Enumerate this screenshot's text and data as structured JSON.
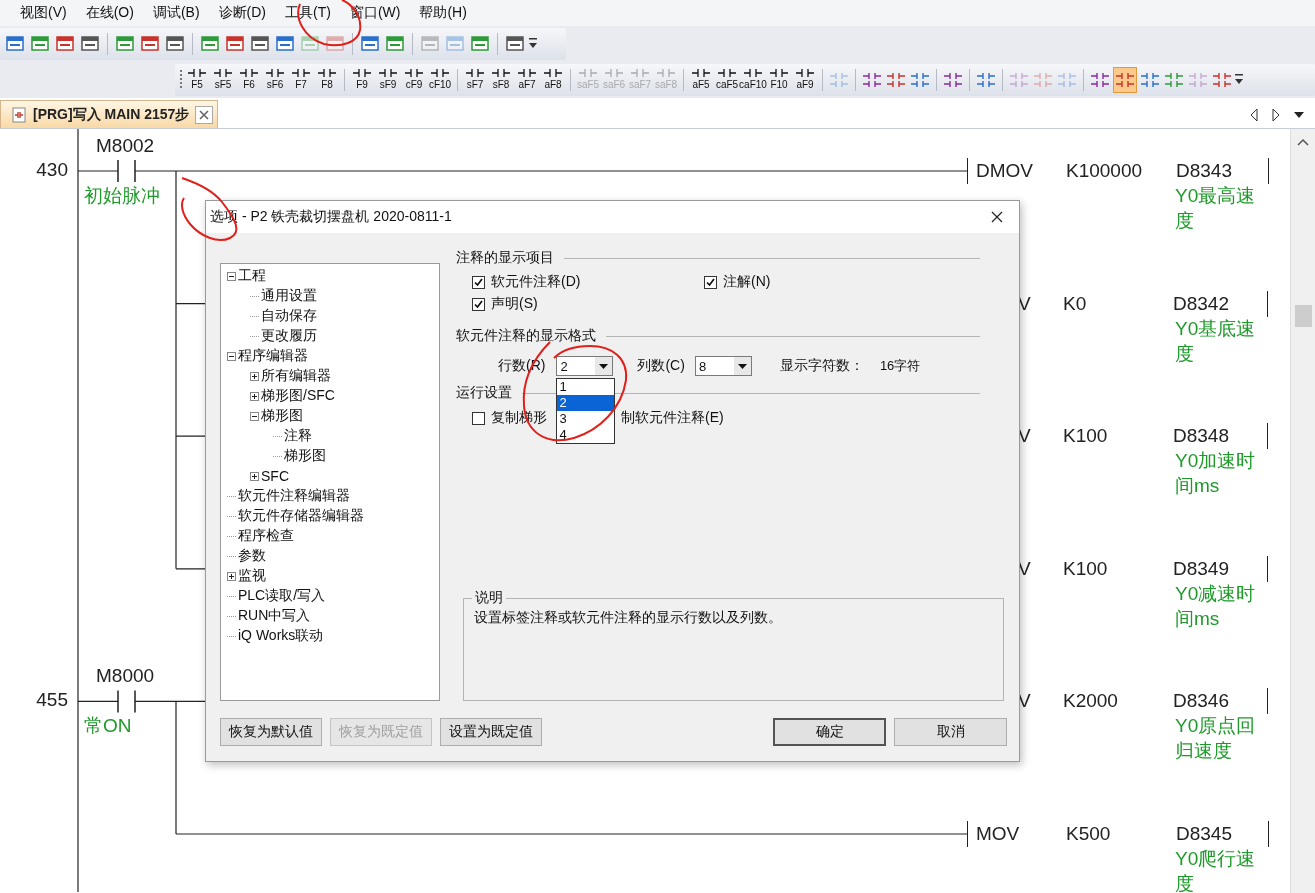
{
  "menu_bar": [
    "视图(V)",
    "在线(O)",
    "调试(B)",
    "诊断(D)",
    "工具(T)",
    "窗口(W)",
    "帮助(H)"
  ],
  "toolbar_1": [
    {
      "kind": "icon",
      "disabled": false
    },
    {
      "kind": "icon",
      "disabled": false
    },
    {
      "kind": "icon",
      "disabled": false
    },
    {
      "kind": "icon",
      "disabled": false
    },
    {
      "kind": "separator"
    },
    {
      "kind": "icon",
      "disabled": false
    },
    {
      "kind": "icon",
      "disabled": false
    },
    {
      "kind": "icon",
      "disabled": false
    },
    {
      "kind": "separator"
    },
    {
      "kind": "icon",
      "disabled": false
    },
    {
      "kind": "icon",
      "disabled": false
    },
    {
      "kind": "icon",
      "disabled": false
    },
    {
      "kind": "icon",
      "disabled": false
    },
    {
      "kind": "icon",
      "disabled": true
    },
    {
      "kind": "icon",
      "disabled": true
    },
    {
      "kind": "separator"
    },
    {
      "kind": "icon",
      "disabled": false
    },
    {
      "kind": "icon",
      "disabled": false
    },
    {
      "kind": "separator"
    },
    {
      "kind": "icon",
      "disabled": true
    },
    {
      "kind": "icon",
      "disabled": true
    },
    {
      "kind": "icon",
      "disabled": false
    },
    {
      "kind": "separator"
    },
    {
      "kind": "icon",
      "disabled": false
    }
  ],
  "toolbar_2": [
    {
      "kind": "key",
      "label": "F5",
      "disabled": false
    },
    {
      "kind": "key",
      "label": "sF5",
      "disabled": false
    },
    {
      "kind": "key",
      "label": "F6",
      "disabled": false
    },
    {
      "kind": "key",
      "label": "sF6",
      "disabled": false
    },
    {
      "kind": "key",
      "label": "F7",
      "disabled": false
    },
    {
      "kind": "key",
      "label": "F8",
      "disabled": false
    },
    {
      "kind": "separator"
    },
    {
      "kind": "key",
      "label": "F9",
      "disabled": false
    },
    {
      "kind": "key",
      "label": "sF9",
      "disabled": false
    },
    {
      "kind": "key",
      "label": "cF9",
      "disabled": false
    },
    {
      "kind": "key",
      "label": "cF10",
      "disabled": false
    },
    {
      "kind": "separator"
    },
    {
      "kind": "key",
      "label": "sF7",
      "disabled": false
    },
    {
      "kind": "key",
      "label": "sF8",
      "disabled": false
    },
    {
      "kind": "key",
      "label": "aF7",
      "disabled": false
    },
    {
      "kind": "key",
      "label": "aF8",
      "disabled": false
    },
    {
      "kind": "separator"
    },
    {
      "kind": "key",
      "label": "saF5",
      "disabled": true
    },
    {
      "kind": "key",
      "label": "saF6",
      "disabled": true
    },
    {
      "kind": "key",
      "label": "saF7",
      "disabled": true
    },
    {
      "kind": "key",
      "label": "saF8",
      "disabled": true
    },
    {
      "kind": "separator"
    },
    {
      "kind": "key",
      "label": "aF5",
      "disabled": false
    },
    {
      "kind": "key",
      "label": "caF5",
      "disabled": false
    },
    {
      "kind": "key",
      "label": "caF10",
      "disabled": false
    },
    {
      "kind": "key",
      "label": "F10",
      "disabled": false
    },
    {
      "kind": "key",
      "label": "aF9",
      "disabled": false
    },
    {
      "kind": "separator"
    },
    {
      "kind": "icon",
      "disabled": true,
      "active": false
    },
    {
      "kind": "separator"
    },
    {
      "kind": "icon",
      "disabled": false,
      "active": false
    },
    {
      "kind": "icon",
      "disabled": false,
      "active": false
    },
    {
      "kind": "icon",
      "disabled": false,
      "active": false
    },
    {
      "kind": "separator"
    },
    {
      "kind": "icon",
      "disabled": false,
      "active": false
    },
    {
      "kind": "separator"
    },
    {
      "kind": "icon",
      "disabled": false,
      "active": false
    },
    {
      "kind": "separator"
    },
    {
      "kind": "icon",
      "disabled": true,
      "active": false
    },
    {
      "kind": "icon",
      "disabled": true,
      "active": false
    },
    {
      "kind": "icon",
      "disabled": true,
      "active": false
    },
    {
      "kind": "separator"
    },
    {
      "kind": "icon",
      "disabled": false,
      "active": false
    },
    {
      "kind": "icon",
      "disabled": false,
      "active": true
    },
    {
      "kind": "icon",
      "disabled": false,
      "active": false
    },
    {
      "kind": "icon",
      "disabled": false,
      "active": false
    },
    {
      "kind": "icon",
      "disabled": true,
      "active": false
    },
    {
      "kind": "icon",
      "disabled": false,
      "active": false
    }
  ],
  "tabs": [
    {
      "label": "[PRG]写入 MAIN 2157步",
      "selected": true
    }
  ],
  "ladder": {
    "rungs": [
      {
        "step": "430",
        "device": "M8002",
        "device_comment": "初始脉冲",
        "outputs": [
          {
            "covered": false,
            "instruction": "DMOV",
            "source": "K100000",
            "destination": "D8343",
            "comment": [
              "Y0最高速",
              "度"
            ]
          },
          {
            "covered": true,
            "instruction": "V",
            "source": "K0",
            "destination": "D8342",
            "comment": [
              "Y0基底速",
              "度"
            ]
          },
          {
            "covered": true,
            "instruction": "V",
            "source": "K100",
            "destination": "D8348",
            "comment": [
              "Y0加速时",
              "间ms"
            ]
          },
          {
            "covered": true,
            "instruction": "V",
            "source": "K100",
            "destination": "D8349",
            "comment": [
              "Y0减速时",
              "间ms"
            ]
          }
        ]
      },
      {
        "step": "455",
        "device": "M8000",
        "device_comment": "常ON",
        "outputs": [
          {
            "covered": true,
            "instruction": "V",
            "source": "K2000",
            "destination": "D8346",
            "comment": [
              "Y0原点回",
              "归速度"
            ]
          },
          {
            "covered": false,
            "instruction": "MOV",
            "source": "K500",
            "destination": "D8345",
            "comment": [
              "Y0爬行速",
              "度"
            ]
          }
        ]
      }
    ]
  },
  "dialog": {
    "title": "选项 - P2 铁壳裁切摆盘机 2020-0811-1",
    "tree": [
      {
        "label": "工程",
        "expanded": true,
        "children": [
          {
            "label": "通用设置"
          },
          {
            "label": "自动保存"
          },
          {
            "label": "更改履历"
          }
        ]
      },
      {
        "label": "程序编辑器",
        "expanded": true,
        "children": [
          {
            "label": "所有编辑器",
            "expanded": false
          },
          {
            "label": "梯形图/SFC",
            "expanded": false
          },
          {
            "label": "梯形图",
            "expanded": true,
            "children": [
              {
                "label": "注释"
              },
              {
                "label": "梯形图"
              }
            ]
          },
          {
            "label": "SFC",
            "expanded": false
          }
        ]
      },
      {
        "label": "软元件注释编辑器"
      },
      {
        "label": "软元件存储器编辑器"
      },
      {
        "label": "程序检查"
      },
      {
        "label": "参数"
      },
      {
        "label": "监视",
        "expanded": false
      },
      {
        "label": "PLC读取/写入"
      },
      {
        "label": "RUN中写入"
      },
      {
        "label": "iQ Works联动"
      }
    ],
    "display_items": {
      "heading": "注释的显示项目",
      "checkboxes": [
        {
          "label": "软元件注释(D)",
          "checked": true
        },
        {
          "label": "注解(N)",
          "checked": true
        },
        {
          "label": "声明(S)",
          "checked": true
        }
      ]
    },
    "format": {
      "heading": "软元件注释的显示格式",
      "rows_label": "行数(R)",
      "rows_value": "2",
      "columns_label": "列数(C)",
      "columns_value": "8",
      "chars_label": "显示字符数：",
      "chars_value": "16字符",
      "rows_list": [
        {
          "label": "1",
          "selected": false
        },
        {
          "label": "2",
          "selected": true
        },
        {
          "label": "3",
          "selected": false
        },
        {
          "label": "4",
          "selected": false
        }
      ]
    },
    "run_settings": {
      "heading": "运行设置",
      "checked": false,
      "label_parts": [
        "复制梯形",
        "制软元件注释(E)"
      ]
    },
    "description": {
      "heading": "说明",
      "text": "设置标签注释或软元件注释的显示行数以及列数。"
    },
    "left_buttons": [
      {
        "label": "恢复为默认值",
        "disabled": false
      },
      {
        "label": "恢复为既定值",
        "disabled": true
      },
      {
        "label": "设置为既定值",
        "disabled": false
      }
    ],
    "right_buttons": [
      {
        "label": "确定",
        "disabled": false,
        "default": true
      },
      {
        "label": "取消",
        "disabled": false,
        "default": false
      }
    ]
  }
}
